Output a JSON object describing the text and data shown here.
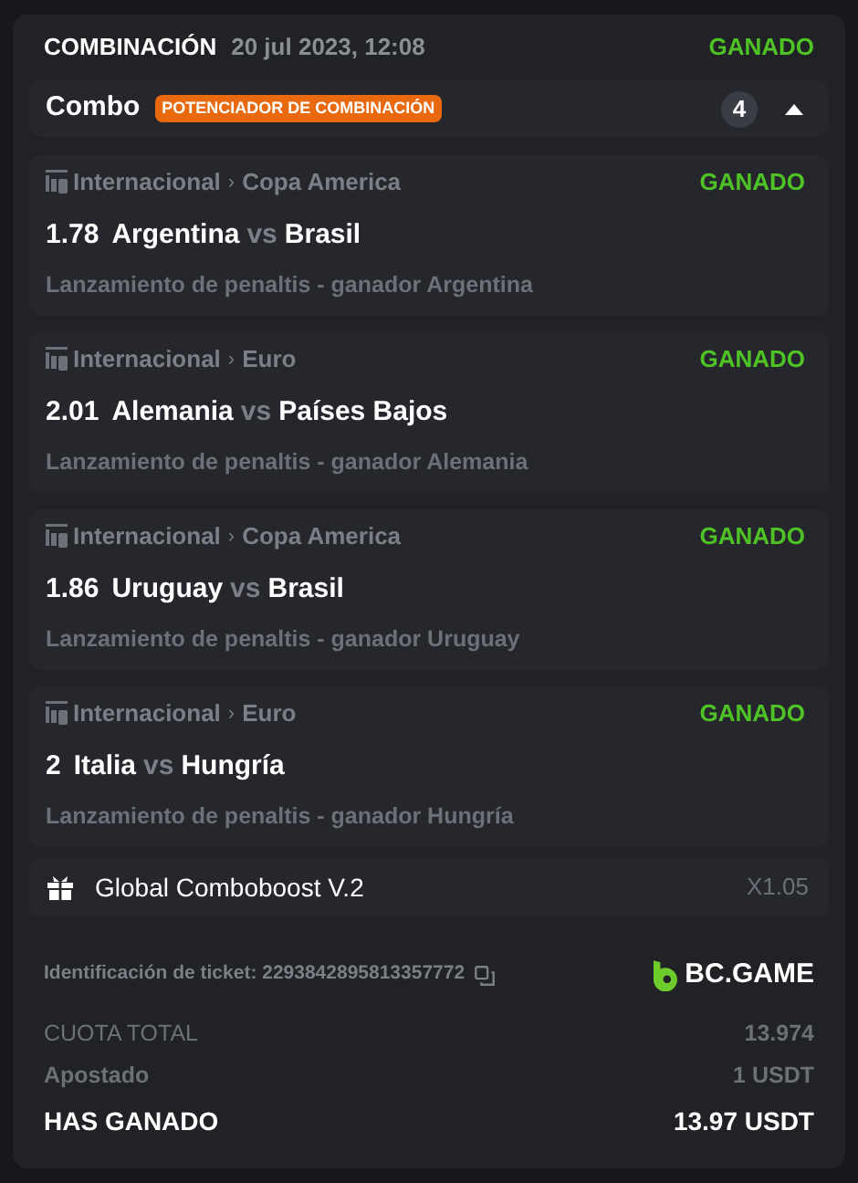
{
  "header": {
    "title": "COMBINACIÓN",
    "date": "20 jul 2023, 12:08",
    "status": "GANADO"
  },
  "combo": {
    "title": "Combo",
    "badge": "POTENCIADOR DE COMBINACIÓN",
    "count": "4",
    "expanded": true
  },
  "legs": [
    {
      "league": "Internacional",
      "separator": "›",
      "tournament": "Copa America",
      "status": "GANADO",
      "odds": "1.78",
      "home": "Argentina",
      "vs": "vs",
      "away": "Brasil",
      "market": "Lanzamiento de penaltis - ganador Argentina"
    },
    {
      "league": "Internacional",
      "separator": "›",
      "tournament": "Euro",
      "status": "GANADO",
      "odds": "2.01",
      "home": "Alemania",
      "vs": "vs",
      "away": "Países Bajos",
      "market": "Lanzamiento de penaltis - ganador Alemania"
    },
    {
      "league": "Internacional",
      "separator": "›",
      "tournament": "Copa America",
      "status": "GANADO",
      "odds": "1.86",
      "home": "Uruguay",
      "vs": "vs",
      "away": "Brasil",
      "market": "Lanzamiento de penaltis - ganador Uruguay"
    },
    {
      "league": "Internacional",
      "separator": "›",
      "tournament": "Euro",
      "status": "GANADO",
      "odds": "2",
      "home": "Italia",
      "vs": "vs",
      "away": "Hungría",
      "market": "Lanzamiento de penaltis - ganador Hungría"
    }
  ],
  "boost": {
    "name": "Global Comboboost V.2",
    "multiplier": "X1.05"
  },
  "ticket": {
    "label": "Identificación de ticket: 2293842895813357772",
    "brand": "BC.GAME"
  },
  "totals": [
    {
      "label": "CUOTA TOTAL",
      "value": "13.974",
      "emphasis": false
    },
    {
      "label": "Apostado",
      "value": "1 USDT",
      "emphasis": false
    },
    {
      "label": "HAS GANADO",
      "value": "13.97 USDT",
      "emphasis": true
    }
  ]
}
